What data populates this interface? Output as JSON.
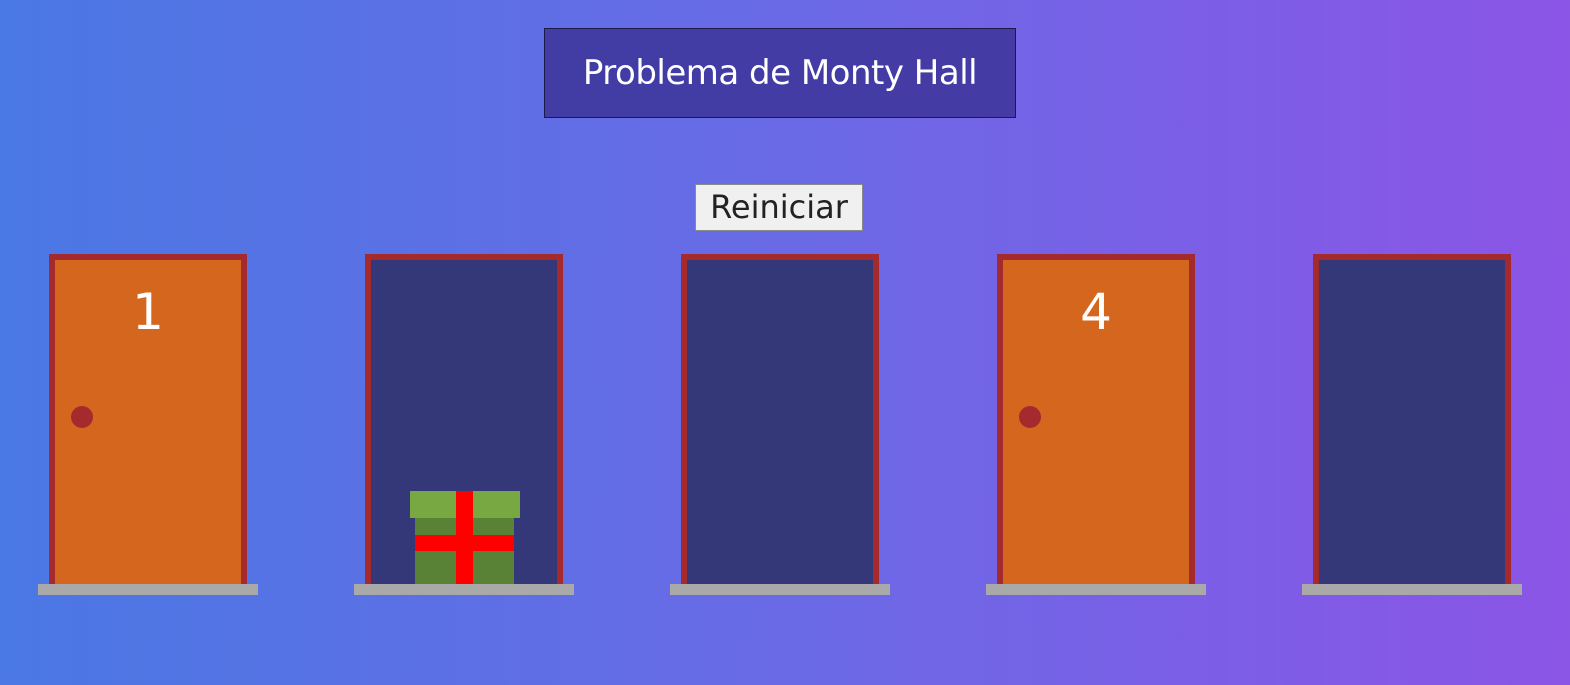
{
  "title": "Problema de Monty Hall",
  "restart_label": "Reiniciar",
  "colors": {
    "background_start": "#4a78e4",
    "background_end": "#8b55e6",
    "title_box": "#3a3296",
    "door_frame": "#a42a2e",
    "door_closed": "#d4661e",
    "door_open": "#343778",
    "sill": "#a9a9a9",
    "gift_lid": "#78a842",
    "gift_box": "#5a8236",
    "gift_ribbon": "#ff0000"
  },
  "doors": [
    {
      "label": "1",
      "state": "closed",
      "has_gift": false
    },
    {
      "label": "",
      "state": "open",
      "has_gift": true
    },
    {
      "label": "",
      "state": "open",
      "has_gift": false
    },
    {
      "label": "4",
      "state": "closed",
      "has_gift": false
    },
    {
      "label": "",
      "state": "open",
      "has_gift": false
    }
  ]
}
